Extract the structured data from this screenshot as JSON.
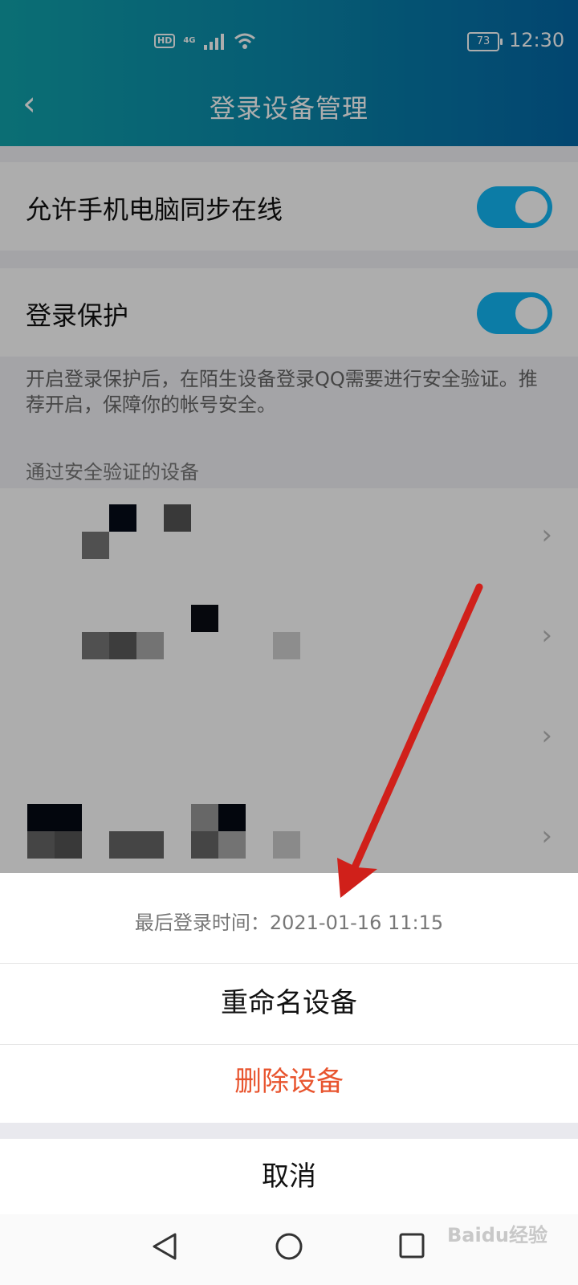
{
  "status_bar": {
    "hd": "HD",
    "network": "4G",
    "battery": "73",
    "time": "12:30"
  },
  "header": {
    "title": "登录设备管理"
  },
  "settings": {
    "sync_online": {
      "label": "允许手机电脑同步在线",
      "enabled": true
    },
    "login_protection": {
      "label": "登录保护",
      "enabled": true
    },
    "protection_hint": "开启登录保护后，在陌生设备登录QQ需要进行安全验证。推荐开启，保障你的帐号安全。"
  },
  "devices_section": {
    "label": "通过安全验证的设备"
  },
  "sheet": {
    "last_login": "最后登录时间：2021-01-16 11:15",
    "rename": "重命名设备",
    "delete": "删除设备",
    "cancel": "取消"
  },
  "colors": {
    "accent": "#12b7f5",
    "danger": "#e8542e",
    "annotation_arrow": "#d0201a"
  },
  "watermark": "Baidu经验"
}
